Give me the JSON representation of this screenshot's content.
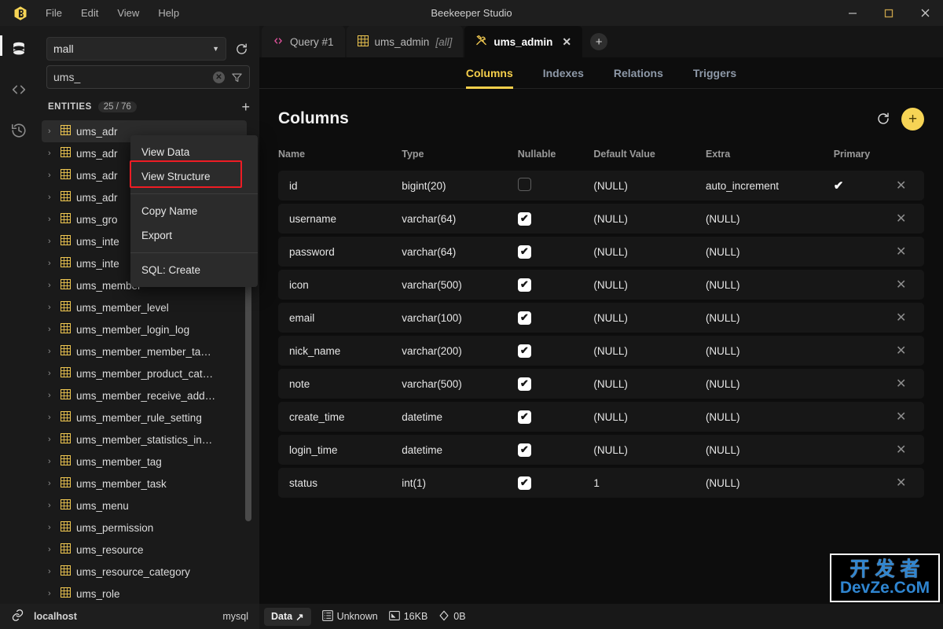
{
  "window": {
    "title": "Beekeeper Studio",
    "menus": [
      "File",
      "Edit",
      "View",
      "Help"
    ],
    "minimize": "–",
    "maximize": "□",
    "close": "✕"
  },
  "rail": {
    "items": [
      {
        "name": "database-icon",
        "label": "Database"
      },
      {
        "name": "code-icon",
        "label": "Query"
      },
      {
        "name": "history-icon",
        "label": "History"
      }
    ]
  },
  "sidebar": {
    "database": {
      "value": "mall",
      "caret": "▼"
    },
    "search": {
      "value": "ums_",
      "placeholder": "Filter"
    },
    "entities": {
      "label": "ENTITIES",
      "count": "25 / 76",
      "add": "+"
    },
    "items": [
      {
        "name": "ums_adr",
        "selected": true
      },
      {
        "name": "ums_adr",
        "selected": false
      },
      {
        "name": "ums_adr",
        "selected": false
      },
      {
        "name": "ums_adr",
        "selected": false
      },
      {
        "name": "ums_gro",
        "selected": false
      },
      {
        "name": "ums_inte",
        "selected": false
      },
      {
        "name": "ums_inte",
        "selected": false
      },
      {
        "name": "ums_member",
        "selected": false
      },
      {
        "name": "ums_member_level",
        "selected": false
      },
      {
        "name": "ums_member_login_log",
        "selected": false
      },
      {
        "name": "ums_member_member_ta…",
        "selected": false
      },
      {
        "name": "ums_member_product_cat…",
        "selected": false
      },
      {
        "name": "ums_member_receive_add…",
        "selected": false
      },
      {
        "name": "ums_member_rule_setting",
        "selected": false
      },
      {
        "name": "ums_member_statistics_in…",
        "selected": false
      },
      {
        "name": "ums_member_tag",
        "selected": false
      },
      {
        "name": "ums_member_task",
        "selected": false
      },
      {
        "name": "ums_menu",
        "selected": false
      },
      {
        "name": "ums_permission",
        "selected": false
      },
      {
        "name": "ums_resource",
        "selected": false
      },
      {
        "name": "ums_resource_category",
        "selected": false
      },
      {
        "name": "ums_role",
        "selected": false
      }
    ]
  },
  "context_menu": {
    "groups": [
      [
        "View Data",
        "View Structure"
      ],
      [
        "Copy Name",
        "Export"
      ],
      [
        "SQL: Create"
      ]
    ],
    "highlighted": "View Structure",
    "highlight_color": "#ee1c24"
  },
  "tabs": [
    {
      "label": "Query #1",
      "icon": "code-icon",
      "suffix": "",
      "active": false,
      "closable": false
    },
    {
      "label": "ums_admin",
      "icon": "table-icon",
      "suffix": "[all]",
      "active": false,
      "closable": false
    },
    {
      "label": "ums_admin",
      "icon": "hammer-wrench-icon",
      "suffix": "",
      "active": true,
      "closable": true
    }
  ],
  "tab_add": "+",
  "subtabs": [
    {
      "label": "Columns",
      "active": true
    },
    {
      "label": "Indexes",
      "active": false
    },
    {
      "label": "Relations",
      "active": false
    },
    {
      "label": "Triggers",
      "active": false
    }
  ],
  "panel": {
    "title": "Columns",
    "refresh_icon": "refresh-icon",
    "add_icon": "+",
    "accent": "#f5cf4b"
  },
  "table": {
    "headers": [
      "Name",
      "Type",
      "Nullable",
      "Default Value",
      "Extra",
      "Primary",
      ""
    ],
    "rows": [
      {
        "name": "id",
        "type": "bigint(20)",
        "nullable": false,
        "default": "(NULL)",
        "default_is_null": true,
        "extra": "auto_increment",
        "extra_is_null": false,
        "primary": true
      },
      {
        "name": "username",
        "type": "varchar(64)",
        "nullable": true,
        "default": "(NULL)",
        "default_is_null": true,
        "extra": "(NULL)",
        "extra_is_null": true,
        "primary": false
      },
      {
        "name": "password",
        "type": "varchar(64)",
        "nullable": true,
        "default": "(NULL)",
        "default_is_null": true,
        "extra": "(NULL)",
        "extra_is_null": true,
        "primary": false
      },
      {
        "name": "icon",
        "type": "varchar(500)",
        "nullable": true,
        "default": "(NULL)",
        "default_is_null": true,
        "extra": "(NULL)",
        "extra_is_null": true,
        "primary": false
      },
      {
        "name": "email",
        "type": "varchar(100)",
        "nullable": true,
        "default": "(NULL)",
        "default_is_null": true,
        "extra": "(NULL)",
        "extra_is_null": true,
        "primary": false
      },
      {
        "name": "nick_name",
        "type": "varchar(200)",
        "nullable": true,
        "default": "(NULL)",
        "default_is_null": true,
        "extra": "(NULL)",
        "extra_is_null": true,
        "primary": false
      },
      {
        "name": "note",
        "type": "varchar(500)",
        "nullable": true,
        "default": "(NULL)",
        "default_is_null": true,
        "extra": "(NULL)",
        "extra_is_null": true,
        "primary": false
      },
      {
        "name": "create_time",
        "type": "datetime",
        "nullable": true,
        "default": "(NULL)",
        "default_is_null": true,
        "extra": "(NULL)",
        "extra_is_null": true,
        "primary": false
      },
      {
        "name": "login_time",
        "type": "datetime",
        "nullable": true,
        "default": "(NULL)",
        "default_is_null": true,
        "extra": "(NULL)",
        "extra_is_null": true,
        "primary": false
      },
      {
        "name": "status",
        "type": "int(1)",
        "nullable": true,
        "default": "1",
        "default_is_null": false,
        "extra": "(NULL)",
        "extra_is_null": true,
        "primary": false
      }
    ],
    "check_on": "✔",
    "primary_mark": "✔",
    "delete_mark": "✕"
  },
  "statusbar": {
    "host": "localhost",
    "engine": "mysql",
    "data_button": "Data",
    "data_arrow": "↗",
    "rows": "Unknown",
    "size": "16KB",
    "index_size": "0B"
  },
  "watermark": {
    "cn": "开发者",
    "en": "DevZe.CoM"
  }
}
